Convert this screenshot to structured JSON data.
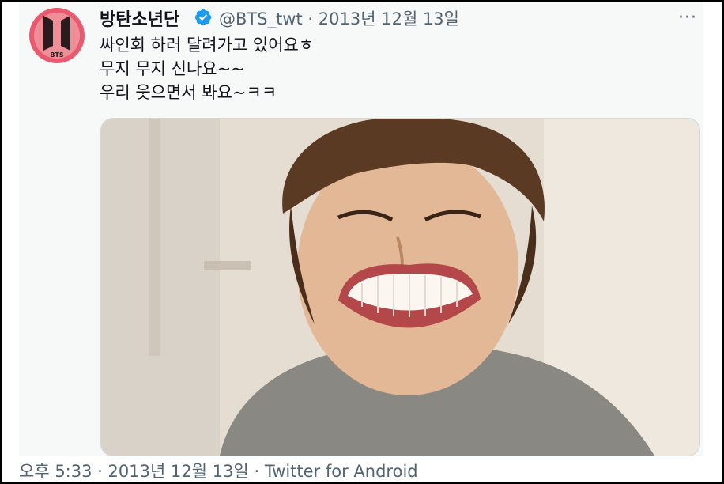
{
  "tweet": {
    "display_name": "방탄소년단",
    "handle": "@BTS_twt",
    "separator": "·",
    "date": "2013년 12월 13일",
    "lines": [
      "싸인회 하러 달려가고 있어요ㅎ",
      "무지 무지 신나요~~",
      "우리 웃으면서 봐요~ㅋㅋ"
    ],
    "more_label": "···"
  },
  "footer": {
    "time": "오후 5:33",
    "sep1": "·",
    "date": "2013년 12월 13일",
    "sep2": "·",
    "source": "Twitter for Android"
  },
  "icons": {
    "avatar": "bts-logo-icon",
    "verified": "verified-badge-icon",
    "more": "more-options-icon"
  },
  "colors": {
    "avatar_bg": "#e85a6f",
    "verified": "#1d9bf0",
    "secondary_text": "#536471",
    "primary_text": "#0f1419"
  }
}
